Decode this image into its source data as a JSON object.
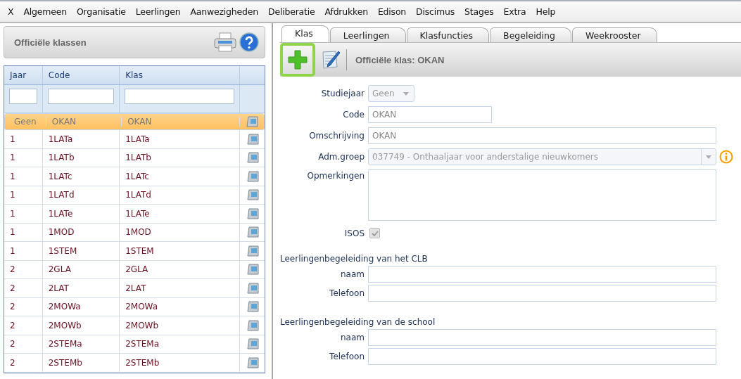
{
  "menu": [
    "X",
    "Algemeen",
    "Organisatie",
    "Leerlingen",
    "Aanwezigheden",
    "Deliberatie",
    "Afdrukken",
    "Edison",
    "Discimus",
    "Stages",
    "Extra",
    "Help"
  ],
  "left_panel": {
    "title": "Officiële klassen"
  },
  "table": {
    "columns": [
      "Jaar",
      "Code",
      "Klas"
    ],
    "rows": [
      {
        "jaar": "Geen",
        "code": "OKAN",
        "klas": "OKAN",
        "selected": true
      },
      {
        "jaar": "1",
        "code": "1LATa",
        "klas": "1LATa",
        "selected": false
      },
      {
        "jaar": "1",
        "code": "1LATb",
        "klas": "1LATb",
        "selected": false
      },
      {
        "jaar": "1",
        "code": "1LATc",
        "klas": "1LATc",
        "selected": false
      },
      {
        "jaar": "1",
        "code": "1LATd",
        "klas": "1LATd",
        "selected": false
      },
      {
        "jaar": "1",
        "code": "1LATe",
        "klas": "1LATe",
        "selected": false
      },
      {
        "jaar": "1",
        "code": "1MOD",
        "klas": "1MOD",
        "selected": false
      },
      {
        "jaar": "1",
        "code": "1STEM",
        "klas": "1STEM",
        "selected": false
      },
      {
        "jaar": "2",
        "code": "2GLA",
        "klas": "2GLA",
        "selected": false
      },
      {
        "jaar": "2",
        "code": "2LAT",
        "klas": "2LAT",
        "selected": false
      },
      {
        "jaar": "2",
        "code": "2MOWa",
        "klas": "2MOWa",
        "selected": false
      },
      {
        "jaar": "2",
        "code": "2MOWb",
        "klas": "2MOWb",
        "selected": false
      },
      {
        "jaar": "2",
        "code": "2STEMa",
        "klas": "2STEMa",
        "selected": false
      },
      {
        "jaar": "2",
        "code": "2STEMb",
        "klas": "2STEMb",
        "selected": false
      }
    ]
  },
  "tabs": [
    {
      "label": "Klas",
      "selected": true
    },
    {
      "label": "Leerlingen",
      "selected": false
    },
    {
      "label": "Klasfuncties",
      "selected": false
    },
    {
      "label": "Begeleiding",
      "selected": false
    },
    {
      "label": "Weekrooster",
      "selected": false
    }
  ],
  "toolbar": {
    "title": "Officiële klas: OKAN"
  },
  "form": [
    {
      "kind": "select",
      "label": "Studiejaar",
      "value": "Geen",
      "disabled": true
    },
    {
      "kind": "short",
      "label": "Code",
      "value": "OKAN"
    },
    {
      "kind": "text",
      "label": "Omschrijving",
      "value": "OKAN"
    },
    {
      "kind": "select-wide",
      "label": "Adm.groep",
      "value": "037749 - Onthaaljaar voor anderstalige nieuwkomers",
      "disabled": true
    },
    {
      "kind": "textarea",
      "label": "Opmerkingen"
    },
    {
      "kind": "checkbox",
      "label": "ISOS",
      "checked": true,
      "disabled": true
    }
  ],
  "sections": [
    {
      "title": "Leerlingenbegeleiding van het CLB",
      "fields": [
        {
          "label": "naam"
        },
        {
          "label": "Telefoon"
        }
      ]
    },
    {
      "title": "Leerlingenbegeleiding van de school",
      "fields": [
        {
          "label": "naam"
        },
        {
          "label": "Telefoon"
        }
      ]
    }
  ]
}
